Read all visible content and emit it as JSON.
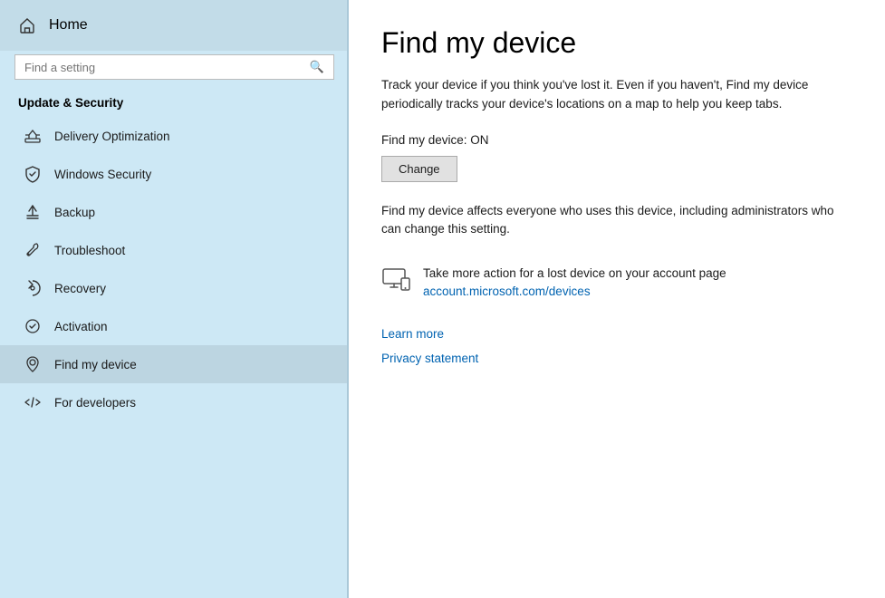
{
  "sidebar": {
    "home_label": "Home",
    "search_placeholder": "Find a setting",
    "section_title": "Update & Security",
    "nav_items": [
      {
        "id": "delivery-optimization",
        "label": "Delivery Optimization",
        "icon": "delivery"
      },
      {
        "id": "windows-security",
        "label": "Windows Security",
        "icon": "shield"
      },
      {
        "id": "backup",
        "label": "Backup",
        "icon": "backup"
      },
      {
        "id": "troubleshoot",
        "label": "Troubleshoot",
        "icon": "wrench"
      },
      {
        "id": "recovery",
        "label": "Recovery",
        "icon": "recovery"
      },
      {
        "id": "activation",
        "label": "Activation",
        "icon": "activation"
      },
      {
        "id": "find-my-device",
        "label": "Find my device",
        "icon": "find-device",
        "active": true
      },
      {
        "id": "for-developers",
        "label": "For developers",
        "icon": "developers"
      }
    ]
  },
  "main": {
    "page_title": "Find my device",
    "description": "Track your device if you think you've lost it. Even if you haven't, Find my device periodically tracks your device's locations on a map to help you keep tabs.",
    "status_label": "Find my device: ON",
    "change_button": "Change",
    "affect_text": "Find my device affects everyone who uses this device, including administrators who can change this setting.",
    "account_section_text": "Take more action for a lost device on your account page",
    "account_link": "account.microsoft.com/devices",
    "footer": {
      "learn_more": "Learn more",
      "privacy_statement": "Privacy statement"
    }
  }
}
